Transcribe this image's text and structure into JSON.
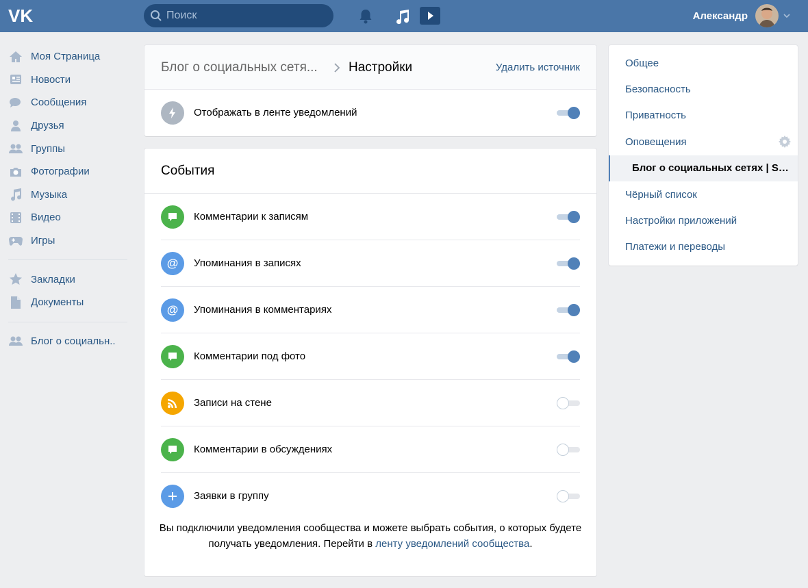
{
  "header": {
    "logo": "VK",
    "search_placeholder": "Поиск",
    "user_name": "Александр"
  },
  "leftnav": {
    "items": [
      {
        "label": "Моя Страница",
        "icon": "home-icon"
      },
      {
        "label": "Новости",
        "icon": "news-icon"
      },
      {
        "label": "Сообщения",
        "icon": "messages-icon"
      },
      {
        "label": "Друзья",
        "icon": "friend-icon"
      },
      {
        "label": "Группы",
        "icon": "groups-icon"
      },
      {
        "label": "Фотографии",
        "icon": "camera-icon"
      },
      {
        "label": "Музыка",
        "icon": "music-icon"
      },
      {
        "label": "Видео",
        "icon": "film-icon"
      },
      {
        "label": "Игры",
        "icon": "gamepad-icon"
      }
    ],
    "items2": [
      {
        "label": "Закладки",
        "icon": "star-icon"
      },
      {
        "label": "Документы",
        "icon": "document-icon"
      }
    ],
    "items3": [
      {
        "label": "Блог о социальн..",
        "icon": "groups-icon"
      }
    ]
  },
  "breadcrumb": {
    "parent": "Блог о социальных сетя...",
    "current": "Настройки",
    "remove_link": "Удалить источник"
  },
  "feed_toggle": {
    "label": "Отображать в ленте уведомлений",
    "on": true,
    "icon": "lightning-icon"
  },
  "events": {
    "title": "События",
    "rows": [
      {
        "label": "Комментарии к записям",
        "on": true,
        "icon": "comment-icon",
        "color": "#4bb34b"
      },
      {
        "label": "Упоминания в записях",
        "on": true,
        "icon": "at-icon",
        "color": "#5b9be6"
      },
      {
        "label": "Упоминания в комментариях",
        "on": true,
        "icon": "at-icon",
        "color": "#5b9be6"
      },
      {
        "label": "Комментарии под фото",
        "on": true,
        "icon": "comment-icon",
        "color": "#4bb34b"
      },
      {
        "label": "Записи на стене",
        "on": false,
        "icon": "rss-icon",
        "color": "#f5a600"
      },
      {
        "label": "Комментарии в обсуждениях",
        "on": false,
        "icon": "comment-icon",
        "color": "#4bb34b"
      },
      {
        "label": "Заявки в группу",
        "on": false,
        "icon": "plus-icon",
        "color": "#5b9be6"
      }
    ],
    "note_line1": "Вы подключили уведомления сообщества и можете выбрать события, о которых будете",
    "note_line2_prefix": "получать уведомления. Перейти в ",
    "note_link": "ленту уведомлений сообщества",
    "note_suffix": "."
  },
  "rightmenu": {
    "items": [
      {
        "label": "Общее"
      },
      {
        "label": "Безопасность"
      },
      {
        "label": "Приватность"
      },
      {
        "label": "Оповещения"
      },
      {
        "label": "Блог о социальных сетях | Social media blog"
      },
      {
        "label": "Чёрный список"
      },
      {
        "label": "Настройки приложений"
      },
      {
        "label": "Платежи и переводы"
      }
    ]
  },
  "colors": {
    "header": "#4a76a8",
    "link": "#2a5885",
    "toggle_on": "#5181b8"
  }
}
